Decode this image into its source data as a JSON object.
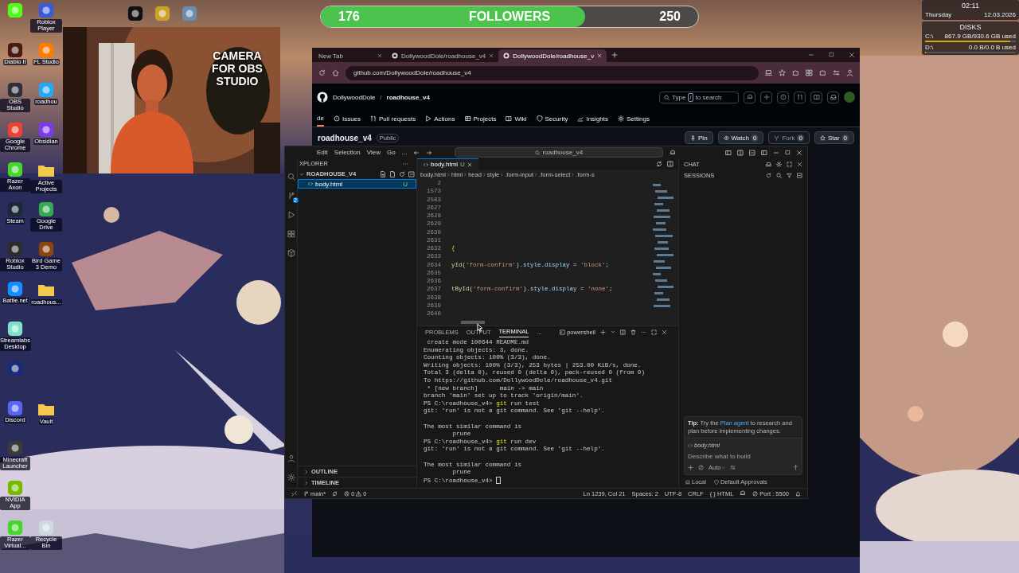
{
  "followers": {
    "current": "176",
    "label": "FOLLOWERS",
    "goal": "250",
    "level": 0.7
  },
  "desktop_icons": {
    "column_1": [
      {
        "kind": "app",
        "color": "#53fc18"
      },
      {
        "kind": "app",
        "label": "Diablo II",
        "color": "#4a1a10"
      },
      {
        "kind": "app",
        "label": "OBS Studio",
        "color": "#302e38"
      },
      {
        "kind": "app",
        "label": "Google Chrome",
        "color": "#ea4335"
      },
      {
        "kind": "app",
        "label": "Razer Axon",
        "color": "#44d62c"
      },
      {
        "kind": "app",
        "label": "Steam",
        "color": "#1b2838"
      },
      {
        "kind": "app",
        "label": "Roblox Studio",
        "color": "#2c2c2c"
      },
      {
        "kind": "app",
        "label": "Battle.net",
        "color": "#148eff"
      },
      {
        "kind": "app",
        "label": "Streamlabs Desktop",
        "color": "#80e0c8"
      },
      {
        "kind": "app",
        "color": "#1a2a7a"
      },
      {
        "kind": "app",
        "label": "Discord",
        "color": "#5865f2"
      },
      {
        "kind": "app",
        "label": "Minecraft Launcher",
        "color": "#3a3a3a"
      },
      {
        "kind": "app",
        "label": "NVIDIA App",
        "color": "#76b900"
      },
      {
        "kind": "app",
        "label": "Razer Virtual...",
        "color": "#44d62c"
      }
    ],
    "column_2": [
      {
        "kind": "app",
        "label": "Roblox Player",
        "color": "#3a5bd9"
      },
      {
        "kind": "app",
        "label": "FL Studio",
        "color": "#ff7a00"
      },
      {
        "kind": "app",
        "label": "roadhou",
        "color": "#23a9f2"
      },
      {
        "kind": "app",
        "label": "Obsidian",
        "color": "#7c3aed"
      },
      {
        "kind": "folder",
        "label": "Active Projects",
        "color": "#f2c94c"
      },
      {
        "kind": "app",
        "label": "Google Drive",
        "color": "#34a853"
      },
      {
        "kind": "app",
        "label": "Bird Game 3 Demo",
        "color": "#8b4513"
      },
      {
        "kind": "folder",
        "label": "roadhous...",
        "color": "#f2c94c"
      },
      {
        "kind": "folder",
        "label": "Vault",
        "color": "#f2c94c"
      },
      {
        "kind": "app",
        "label": "Recycle Bin",
        "color": "#cfd8dc"
      }
    ],
    "top_row": [
      {
        "kind": "app",
        "color": "#111111"
      },
      {
        "kind": "app",
        "color": "#c9a227"
      },
      {
        "kind": "app",
        "color": "#6a8caf"
      }
    ]
  },
  "camera": {
    "kind": "picture",
    "caption": "CAMERA FOR OBS STUDIO"
  },
  "clock_widget": {
    "time": "02:11",
    "day": "Thursday",
    "date": "12.03.2026",
    "disks_title": "DISKS",
    "disks": [
      {
        "drive": "C:\\",
        "usage": "867.9 GB/930.6 GB used",
        "level": 0.93
      },
      {
        "drive": "D:\\",
        "usage": "0.0 B/0.0 B used",
        "level": 0
      }
    ]
  },
  "browser": {
    "tabs": [
      {
        "title": "New Tab",
        "selected": false,
        "favicon": false
      },
      {
        "title": "DollywoodDole/roadhouse_v4",
        "selected": false,
        "favicon": true
      },
      {
        "title": "DollywoodDole/roadhouse_v",
        "selected": true,
        "favicon": true
      }
    ],
    "url": "github.com/DollywoodDole/roadhouse_v4",
    "github": {
      "owner": "DollywoodDole",
      "separator": "/",
      "repo": "roadhouse_v4",
      "search_before": "Type",
      "search_key": "/",
      "search_after": "to search",
      "nav": [
        {
          "label": "de",
          "selected": true
        },
        {
          "label": "Issues",
          "selected": false
        },
        {
          "label": "Pull requests",
          "selected": false
        },
        {
          "label": "Actions",
          "selected": false
        },
        {
          "label": "Projects",
          "selected": false
        },
        {
          "label": "Wiki",
          "selected": false
        },
        {
          "label": "Security",
          "selected": false
        },
        {
          "label": "Insights",
          "selected": false
        },
        {
          "label": "Settings",
          "selected": false
        }
      ],
      "repo_title": "roadhouse_v4",
      "visibility": "Public",
      "actions": [
        {
          "label": "Pin",
          "disabled": false
        },
        {
          "label": "Watch",
          "count": "0",
          "disabled": false
        },
        {
          "label": "Fork",
          "count": "0",
          "disabled": true
        },
        {
          "label": "Star",
          "count": "0",
          "disabled": false
        }
      ]
    }
  },
  "vscode": {
    "menu": [
      "Edit",
      "Selection",
      "View",
      "Go",
      "..."
    ],
    "command_center": "roadhouse_v4",
    "source_control_badge": "2",
    "explorer": {
      "title": "XPLORER",
      "folder": "ROADHOUSE_V4",
      "files": [
        {
          "name": "body.html",
          "badge": "U",
          "selected": true
        }
      ],
      "sections": [
        "OUTLINE",
        "TIMELINE"
      ]
    },
    "editor": {
      "tab": {
        "name": "body.html",
        "badge": "U"
      },
      "breadcrumbs": [
        "body.html",
        "html",
        "head",
        "style",
        ".form-input",
        ".form-select",
        ".form-s"
      ],
      "lines": [
        {
          "number": "2"
        },
        {
          "number": "1573"
        },
        {
          "number": "2583"
        },
        {
          "number": "2627"
        },
        {
          "number": "2628"
        },
        {
          "number": "2629"
        },
        {
          "number": "2630"
        },
        {
          "number": "2631"
        },
        {
          "number": "2632",
          "tokens": [
            {
              "kind": "bracket",
              "text": "{"
            }
          ]
        },
        {
          "number": "2633"
        },
        {
          "number": "2634",
          "tokens": [
            {
              "kind": "fn",
              "text": "yId"
            },
            {
              "kind": "plain",
              "text": "("
            },
            {
              "kind": "str",
              "text": "'form-confirm'"
            },
            {
              "kind": "plain",
              "text": ")"
            },
            {
              "kind": "prop",
              "text": ".style.display"
            },
            {
              "kind": "plain",
              "text": " = "
            },
            {
              "kind": "str",
              "text": "'block'"
            },
            {
              "kind": "plain",
              "text": ";"
            }
          ]
        },
        {
          "number": "2635"
        },
        {
          "number": "2636"
        },
        {
          "number": "2637",
          "tokens": [
            {
              "kind": "fn",
              "text": "tById"
            },
            {
              "kind": "plain",
              "text": "("
            },
            {
              "kind": "str",
              "text": "'form-confirm'"
            },
            {
              "kind": "plain",
              "text": ")"
            },
            {
              "kind": "prop",
              "text": ".style.display"
            },
            {
              "kind": "plain",
              "text": " = "
            },
            {
              "kind": "str",
              "text": "'none'"
            },
            {
              "kind": "plain",
              "text": ";"
            }
          ]
        },
        {
          "number": "2638"
        },
        {
          "number": "2639"
        },
        {
          "number": "2640"
        }
      ]
    },
    "panel": {
      "tabs": [
        {
          "label": "PROBLEMS",
          "selected": false
        },
        {
          "label": "OUTPUT",
          "selected": false
        },
        {
          "label": "TERMINAL",
          "selected": true
        }
      ],
      "more": "...",
      "shell": "powershell",
      "terminal": [
        {
          "kind": "output",
          "text": " create mode 100644 README.md"
        },
        {
          "kind": "output",
          "text": "Enumerating objects: 3, done."
        },
        {
          "kind": "output",
          "text": "Counting objects: 100% (3/3), done."
        },
        {
          "kind": "output",
          "text": "Writing objects: 100% (3/3), 253 bytes | 253.00 KiB/s, done."
        },
        {
          "kind": "output",
          "text": "Total 3 (delta 0), reused 0 (delta 0), pack-reused 0 (from 0)"
        },
        {
          "kind": "output",
          "text": "To https://github.com/DollywoodDole/roadhouse_v4.git"
        },
        {
          "kind": "output",
          "text": " * [new branch]      main -> main"
        },
        {
          "kind": "output",
          "text": "branch 'main' set up to track 'origin/main'."
        },
        {
          "kind": "command",
          "prompt": "PS C:\\roadhouse_v4> ",
          "program": "git",
          "args": " run test"
        },
        {
          "kind": "output",
          "text": "git: 'run' is not a git command. See 'git --help'."
        },
        {
          "kind": "blank"
        },
        {
          "kind": "output",
          "text": "The most similar command is"
        },
        {
          "kind": "output",
          "text": "        prune"
        },
        {
          "kind": "command",
          "prompt": "PS C:\\roadhouse_v4> ",
          "program": "git",
          "args": " run dev"
        },
        {
          "kind": "output",
          "text": "git: 'run' is not a git command. See 'git --help'."
        },
        {
          "kind": "blank"
        },
        {
          "kind": "output",
          "text": "The most similar command is"
        },
        {
          "kind": "output",
          "text": "        prune"
        },
        {
          "kind": "input",
          "prompt": "PS C:\\roadhouse_v4> "
        }
      ]
    },
    "chat": {
      "title": "CHAT",
      "sessions": "SESSIONS",
      "tip_before": "**Tip:** Try the",
      "tip_link": "Plan agent",
      "tip_after": "to research and plan before implementing changes.",
      "context_file": "body.html",
      "placeholder": "Describe what to build",
      "mode": "Auto",
      "location": "Local",
      "approvals": "Default Approvals"
    },
    "status_bar": {
      "branch": "main*",
      "errors": "0",
      "warnings": "0",
      "position": "Ln 1239, Col 21",
      "spaces": "Spaces: 2",
      "encoding": "UTF-8",
      "eol": "CRLF",
      "language": "{ } HTML",
      "port": "Port : 5500"
    }
  }
}
